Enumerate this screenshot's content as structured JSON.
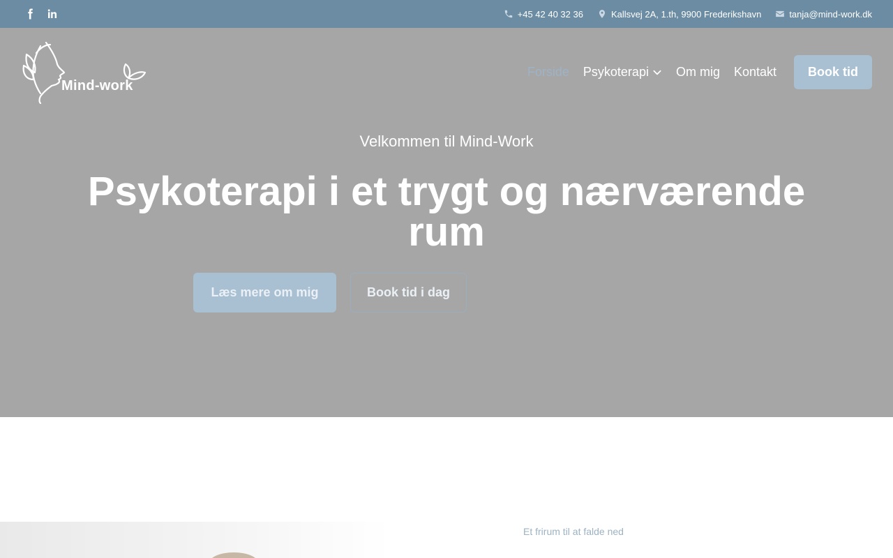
{
  "topbar": {
    "social": [
      {
        "icon": "facebook-icon"
      },
      {
        "icon": "linkedin-icon"
      }
    ],
    "phone": "+45 42 40 32 36",
    "address": "Kallsvej 2A, 1.th, 9900 Frederikshavn",
    "email": "tanja@mind-work.dk",
    "background_color": "#6b8ca2"
  },
  "header": {
    "logo_text": "Mind-work",
    "nav": [
      {
        "label": "Forside",
        "active": true
      },
      {
        "label": "Psykoterapi",
        "has_dropdown": true
      },
      {
        "label": "Om mig"
      },
      {
        "label": "Kontakt"
      }
    ],
    "cta_label": "Book tid",
    "accent_color": "#a9c0d3"
  },
  "hero": {
    "welcome": "Velkommen til Mind-Work",
    "headline": "Psykoterapi i et trygt og nærværende rum",
    "primary_button": "Læs mere om mig",
    "secondary_button": "Book tid i dag",
    "background_color": "#a6a6a6"
  },
  "section": {
    "eyebrow": "Et frirum til at falde ned"
  }
}
